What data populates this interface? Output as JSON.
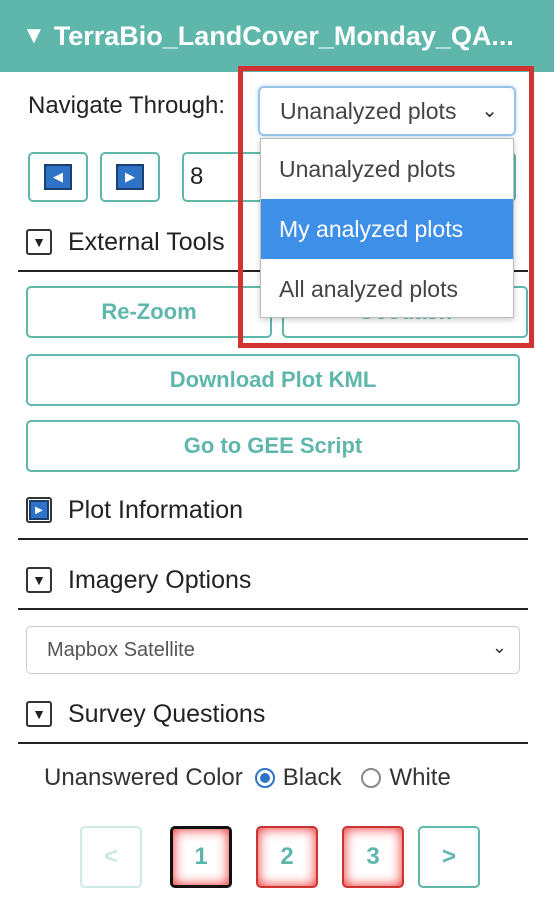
{
  "header": {
    "title": "TerraBio_LandCover_Monday_QA...",
    "toggle_glyph": "▼"
  },
  "navigate": {
    "label": "Navigate Through:",
    "selected": "Unanalyzed plots",
    "options": [
      "Unanalyzed plots",
      "My analyzed plots",
      "All analyzed plots"
    ],
    "highlighted_option_index": 1
  },
  "plot_nav": {
    "plot_id_value": "8"
  },
  "sections": {
    "external_tools": "External Tools",
    "plot_information": "Plot Information",
    "imagery_options": "Imagery Options",
    "survey_questions": "Survey Questions"
  },
  "buttons": {
    "rezoom": "Re-Zoom",
    "geodash": "Geodash",
    "download_kml": "Download Plot KML",
    "gee_script": "Go to GEE Script"
  },
  "imagery": {
    "selected": "Mapbox Satellite"
  },
  "unanswered": {
    "label": "Unanswered Color",
    "options": [
      "Black",
      "White"
    ],
    "selected": "Black"
  },
  "pagination": {
    "prev": "<",
    "pages": [
      "1",
      "2",
      "3"
    ],
    "next": ">",
    "active_page": "1"
  },
  "colors": {
    "accent": "#5fb7ac",
    "highlight": "#d23232",
    "selected_option": "#3d8fe8"
  }
}
